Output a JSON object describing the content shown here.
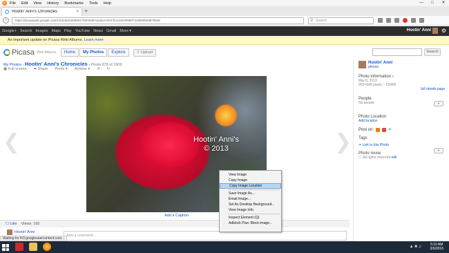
{
  "browser": {
    "menu": [
      "File",
      "Edit",
      "View",
      "History",
      "Bookmarks",
      "Tools",
      "Help"
    ],
    "tab_title": "Hootin' Anni's Chronicles",
    "tab_close": "×",
    "new_tab": "+",
    "url": "https://picasaweb.google.com/101645216089917020348/HootinAnnisChronicles#5907419680528876546",
    "search_placeholder": "Search",
    "status": "Waiting for lh3.googleusercontent.com..."
  },
  "google_bar": {
    "links": [
      "Google+",
      "Search",
      "Images",
      "Maps",
      "Play",
      "YouTube",
      "News",
      "Gmail",
      "More ▾"
    ],
    "user": "Hootin' Anni"
  },
  "notice": {
    "text": "An important update on Picasa Web Albums.",
    "link": "Learn more"
  },
  "picasa": {
    "logo": "Picasa",
    "logo_sub": "Web Albums",
    "tabs": [
      "Home",
      "My Photos",
      "Explore"
    ],
    "upload": "Upload",
    "search_button": "Search"
  },
  "crumb": {
    "my_photos": "My Photos",
    "sep": "›",
    "album": "Hootin' Anni's Chronicles",
    "count": "Photo 678 of 1909"
  },
  "actions": {
    "full_screen": "Full screen",
    "share": "Share",
    "prints": "Prints ▾",
    "actions": "Actions ▾"
  },
  "photo": {
    "watermark_line1": "Hootin' Anni's",
    "watermark_line2": "© 2013",
    "caption": "Add a Caption"
  },
  "bottom": {
    "like": "Like",
    "views": "Views: 165",
    "commenter": "Hootin' Anni",
    "comment_placeholder": "Add a comment..."
  },
  "sidebar": {
    "owner": "Hootin' Anni",
    "owner_sub": "photos",
    "photo_info_title": "Photo information ›",
    "photo_date": "Mar 8, 2013",
    "photo_dims": "952×848 pixels – 159KB",
    "full_details": "full details page",
    "people_title": "People",
    "people_text": "No people",
    "location_title": "Photo Location",
    "location_link": "Add location",
    "post_on": "Post on:",
    "tags_title": "Tags",
    "link_to_photo": "Link to this Photo",
    "reuse_title": "Photo reuse",
    "reuse_text": "All rights reserved",
    "reuse_link": "edit",
    "plus_label": "+"
  },
  "context_menu": {
    "items": [
      "View Image",
      "Copy Image",
      "Copy Image Location",
      "Save Image As...",
      "Email Image...",
      "Set As Desktop Background...",
      "View Image Info",
      "Inspect Element (Q)",
      "Adblock Plus: Block image..."
    ]
  },
  "taskbar": {
    "time": "5:10 AM",
    "date": "3/6/2016"
  },
  "colors": {
    "link": "#1155cc",
    "gbar": "#2d2d2d",
    "notice_bg": "#fff7c8",
    "menu_highlight": "#b7d6f5"
  }
}
